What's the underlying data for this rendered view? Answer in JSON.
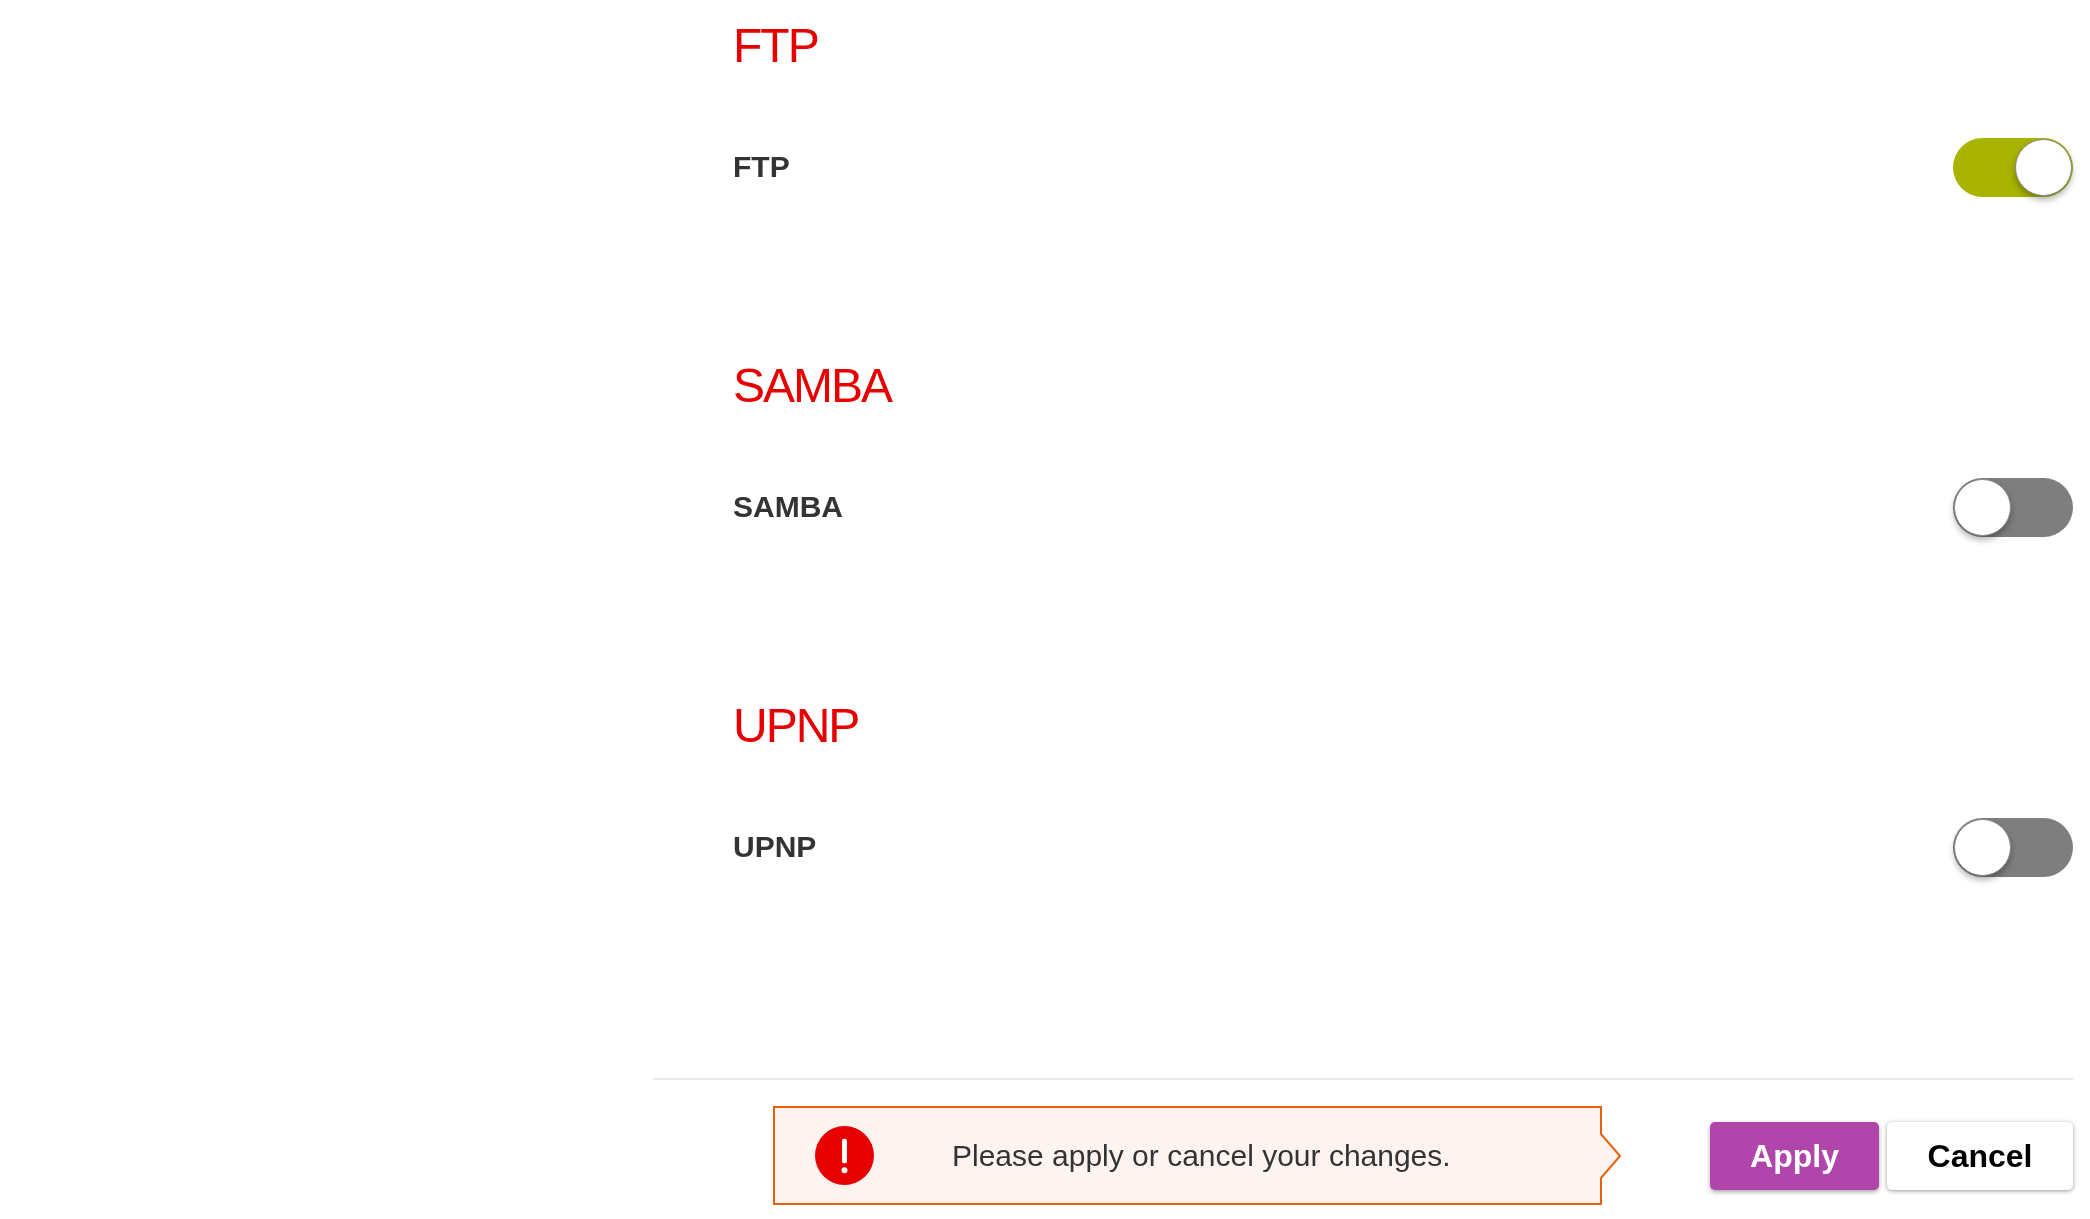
{
  "sections": [
    {
      "title": "FTP",
      "settings": [
        {
          "label": "FTP",
          "on": true
        }
      ]
    },
    {
      "title": "SAMBA",
      "settings": [
        {
          "label": "SAMBA",
          "on": false
        }
      ]
    },
    {
      "title": "UPNP",
      "settings": [
        {
          "label": "UPNP",
          "on": false
        }
      ]
    }
  ],
  "notice": {
    "text": "Please apply or cancel your changes."
  },
  "buttons": [
    {
      "label": "Apply",
      "kind": "primary"
    },
    {
      "label": "Cancel",
      "kind": "secondary"
    }
  ]
}
